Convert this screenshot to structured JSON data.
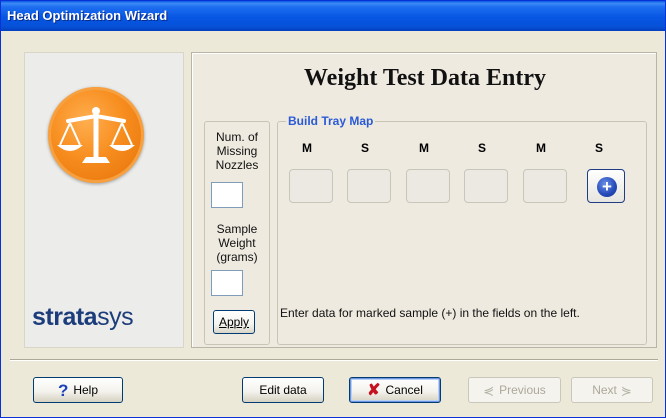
{
  "window": {
    "title": "Head Optimization Wizard"
  },
  "brand": {
    "name_bold": "strata",
    "name_light": "sys",
    "logo_icon": "balance-scale-icon"
  },
  "content": {
    "heading": "Weight Test Data Entry",
    "entry": {
      "nozzles_label_1": "Num. of",
      "nozzles_label_2": "Missing",
      "nozzles_label_3": "Nozzles",
      "nozzles_value": "",
      "weight_label_1": "Sample",
      "weight_label_2": "Weight",
      "weight_label_3": "(grams)",
      "weight_value": "",
      "apply_label": "Apply"
    },
    "tray_map": {
      "legend": "Build Tray Map",
      "columns": [
        "M",
        "S",
        "M",
        "S",
        "M",
        "S"
      ],
      "instructions": "Enter data for marked sample (+) in the fields on the left.",
      "marked_slot_symbol": "+"
    }
  },
  "buttons": {
    "help": "Help",
    "edit_data": "Edit data",
    "cancel": "Cancel",
    "previous": "Previous",
    "next": "Next"
  }
}
